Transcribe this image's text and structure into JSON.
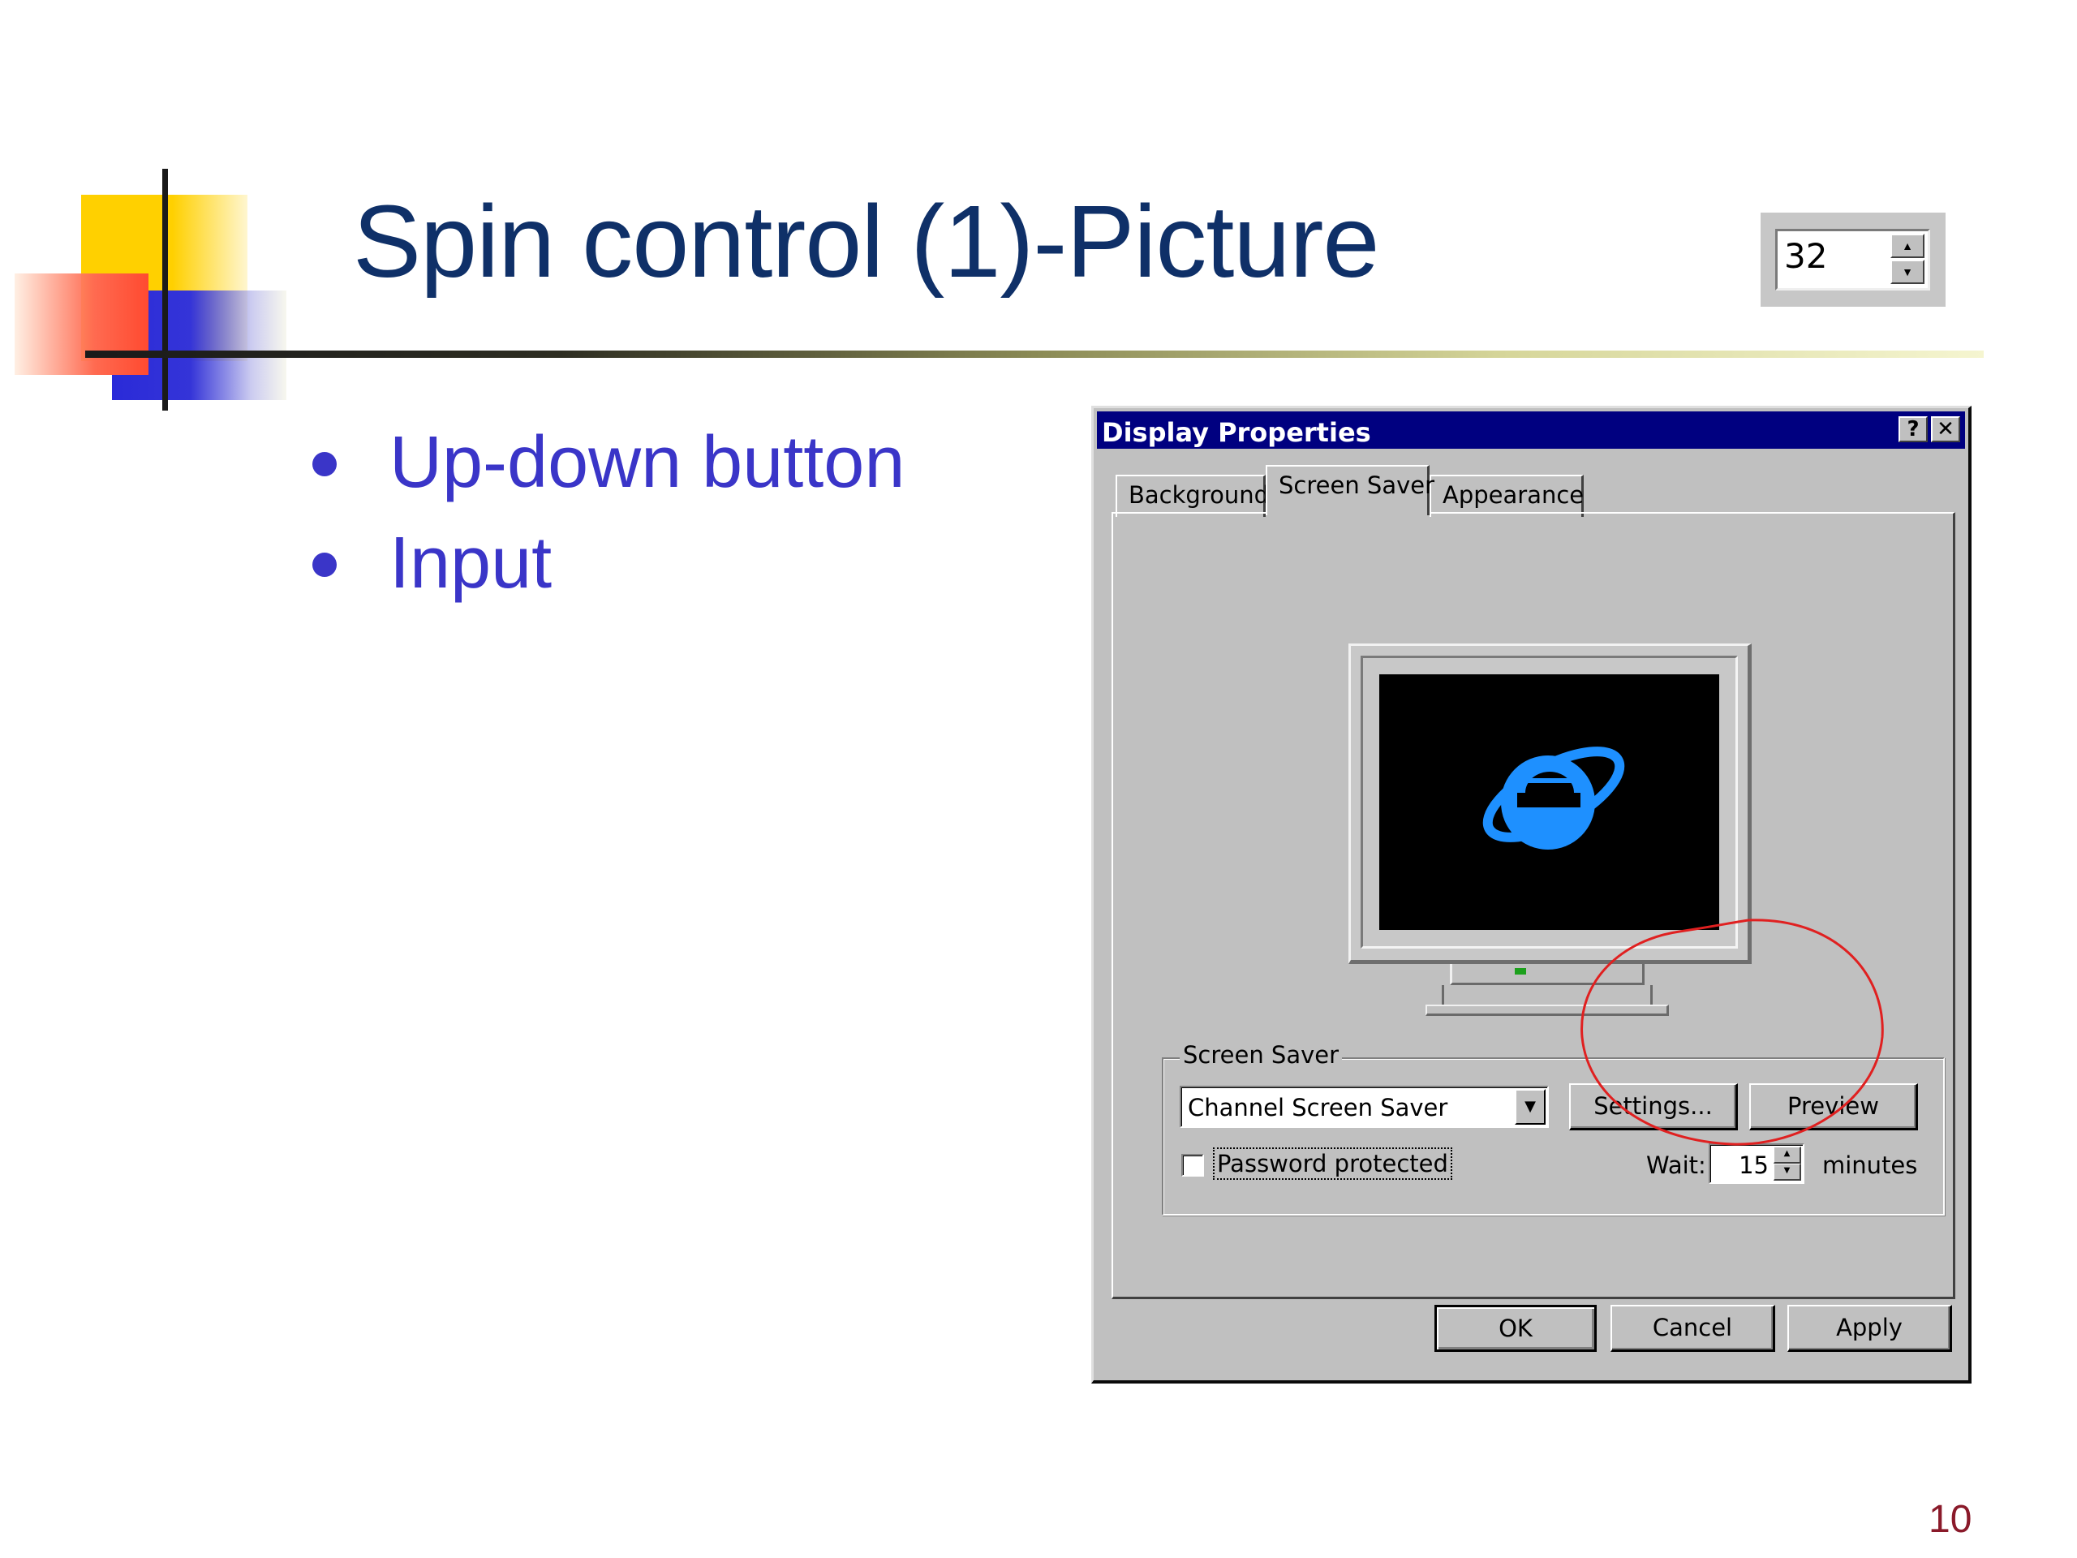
{
  "slide": {
    "title": "Spin control (1)-Picture",
    "bullets": [
      "Up-down button",
      "Input"
    ],
    "page_number": "10"
  },
  "spin_sample": {
    "value": "32"
  },
  "dialog": {
    "title": "Display Properties",
    "help_label": "?",
    "close_label": "✕",
    "tabs": [
      {
        "label": "Background",
        "active": false
      },
      {
        "label": "Screen Saver",
        "active": true
      },
      {
        "label": "Appearance",
        "active": false
      }
    ],
    "screen_saver_group": {
      "label": "Screen Saver",
      "selected": "Channel Screen Saver",
      "settings_label": "Settings...",
      "preview_label": "Preview",
      "password_label": "Password protected",
      "password_checked": false,
      "wait_label": "Wait:",
      "wait_value": "15",
      "minutes_label": "minutes"
    },
    "footer": {
      "ok": "OK",
      "cancel": "Cancel",
      "apply": "Apply"
    }
  },
  "icons": [
    "internet-explorer-logo",
    "monitor-icon",
    "dropdown-arrow-icon",
    "spin-up-icon",
    "spin-down-icon",
    "help-icon",
    "close-icon"
  ],
  "colors": {
    "title": "#0f3068",
    "bullet": "#3a35c8",
    "titlebar": "#000080",
    "face": "#c0c0c0",
    "annotation": "#e02020",
    "page_number": "#8a1a2a"
  }
}
